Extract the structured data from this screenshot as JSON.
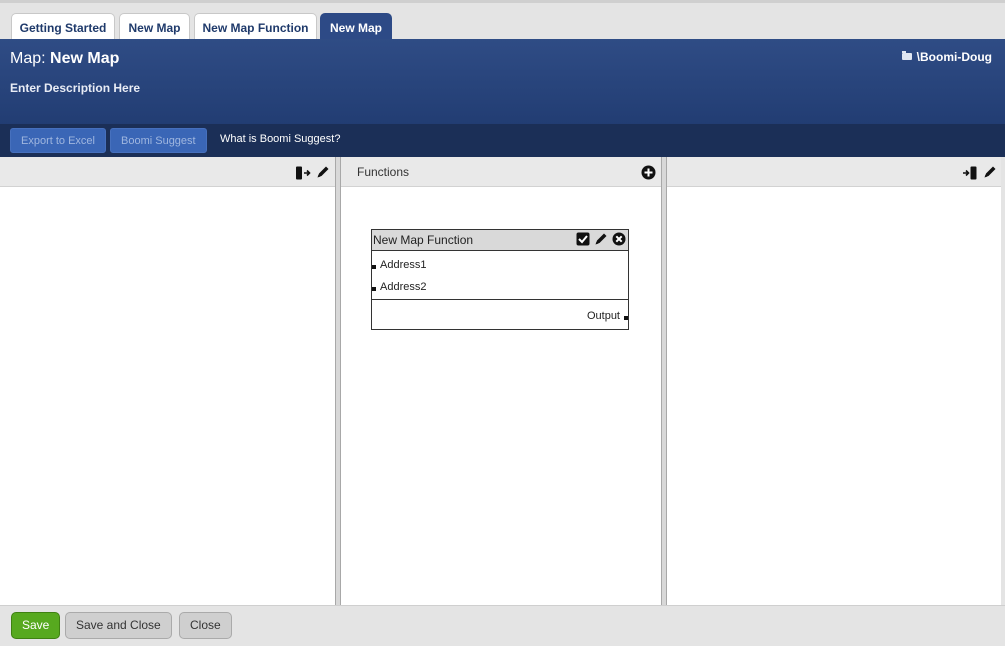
{
  "tabs": [
    {
      "label": "Getting Started"
    },
    {
      "label": "New Map"
    },
    {
      "label": "New Map Function"
    },
    {
      "label": "New Map",
      "active": true
    }
  ],
  "header": {
    "map_label": "Map:",
    "map_name": "New Map",
    "description": "Enter Description Here",
    "user_path": "\\Boomi-Doug"
  },
  "toolbar": {
    "export_label": "Export to Excel",
    "suggest_label": "Boomi Suggest",
    "what_is_label": "What is Boomi Suggest?"
  },
  "functions_panel": {
    "title": "Functions"
  },
  "function_box": {
    "title": "New Map Function",
    "inputs": [
      "Address1",
      "Address2"
    ],
    "output": "Output"
  },
  "footer": {
    "save_label": "Save",
    "save_close_label": "Save and Close",
    "close_label": "Close"
  },
  "colors": {
    "header_blue": "#2d4a86",
    "toolbar_navy": "#1b2f57",
    "save_green": "#57a91f"
  },
  "icons": [
    "folder-icon",
    "source-profile-icon",
    "edit-icon",
    "add-function-icon",
    "destination-profile-icon",
    "checkmark-icon",
    "close-circle-icon"
  ]
}
